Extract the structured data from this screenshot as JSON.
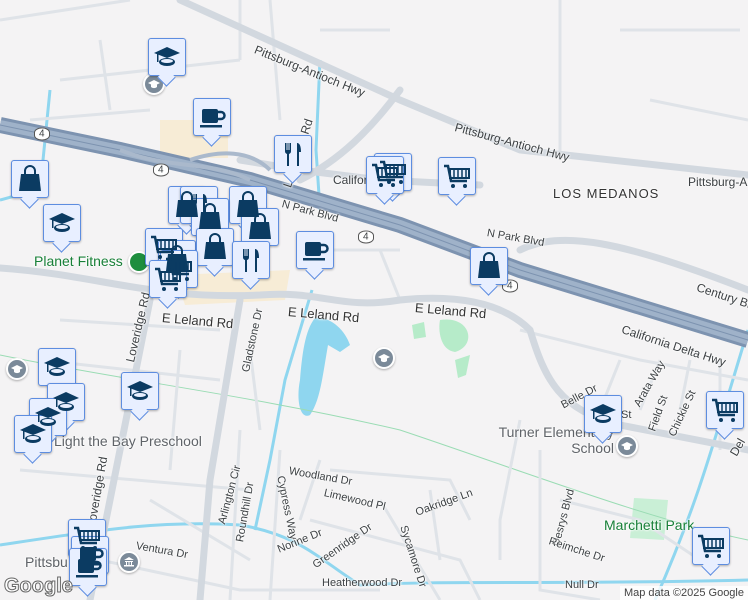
{
  "roads": {
    "pittsburg_antioch_hwy_1": "Pittsburg-Antioch Hwy",
    "pittsburg_antioch_hwy_2": "Pittsburg-Antioch Hwy",
    "pittsburg_antioch_hwy_3": "Pittsburg-Antioch Hwy",
    "california_delta_hwy": "California Delta Hwy",
    "california_delta_hwy_short": "Californ",
    "n_park_blvd_1": "N Park Blvd",
    "n_park_blvd_2": "N Park Blvd",
    "loveridge_rd_1": "Loveridge Rd",
    "loveridge_rd_2": "Loveridge Rd",
    "loveridge_rd_3": "Loveridge Rd",
    "e_leland_rd_1": "E Leland Rd",
    "e_leland_rd_2": "E Leland Rd",
    "e_leland_rd_3": "E Leland Rd",
    "gladstone_dr": "Gladstone Dr",
    "century_blvd": "Century Bl",
    "belle_dr": "Belle Dr",
    "arata_way": "Arata Way",
    "field_st": "Field St",
    "chickie_st": "Chickie St",
    "st": "St",
    "delta": "Del",
    "woodland_dr": "Woodland Dr",
    "limewood_pl": "Limewood Pl",
    "oakridge_ln": "Oakridge Ln",
    "cypress_way": "Cypress Way",
    "roundhill_dr": "Roundhill Dr",
    "arlington_cir": "Arlington Cir",
    "norine_dr": "Norine Dr",
    "greenridge_dr": "Greenridge Dr",
    "sycamore_dr": "Sycamore Dr",
    "desrys_blvd": "Desrys Blvd",
    "reimche_dr": "Reimche Dr",
    "ventura_dr": "Ventura Dr",
    "heatherwood_dr": "Heatherwood Dr",
    "null_dr": "Null Dr",
    "hwy4_shield": "4"
  },
  "places": {
    "los_medanos": "LOS MEDANOS",
    "planet_fitness": "Planet Fitness",
    "light_the_bay": "Light the Bay Preschool",
    "turner_elementary": "Turner Elementary School",
    "marchetti_park": "Marchetti Park",
    "pittsburg": "Pittsbu"
  },
  "footer": {
    "logo": "Google",
    "attribution": "Map data ©2025 Google"
  },
  "colors": {
    "highway": "#8ea3bd",
    "water": "#8fd6ef",
    "park": "#b6ebc9",
    "marker_fill": "#e8efff",
    "marker_border": "#5d8de0",
    "icon": "#0b3b62"
  }
}
